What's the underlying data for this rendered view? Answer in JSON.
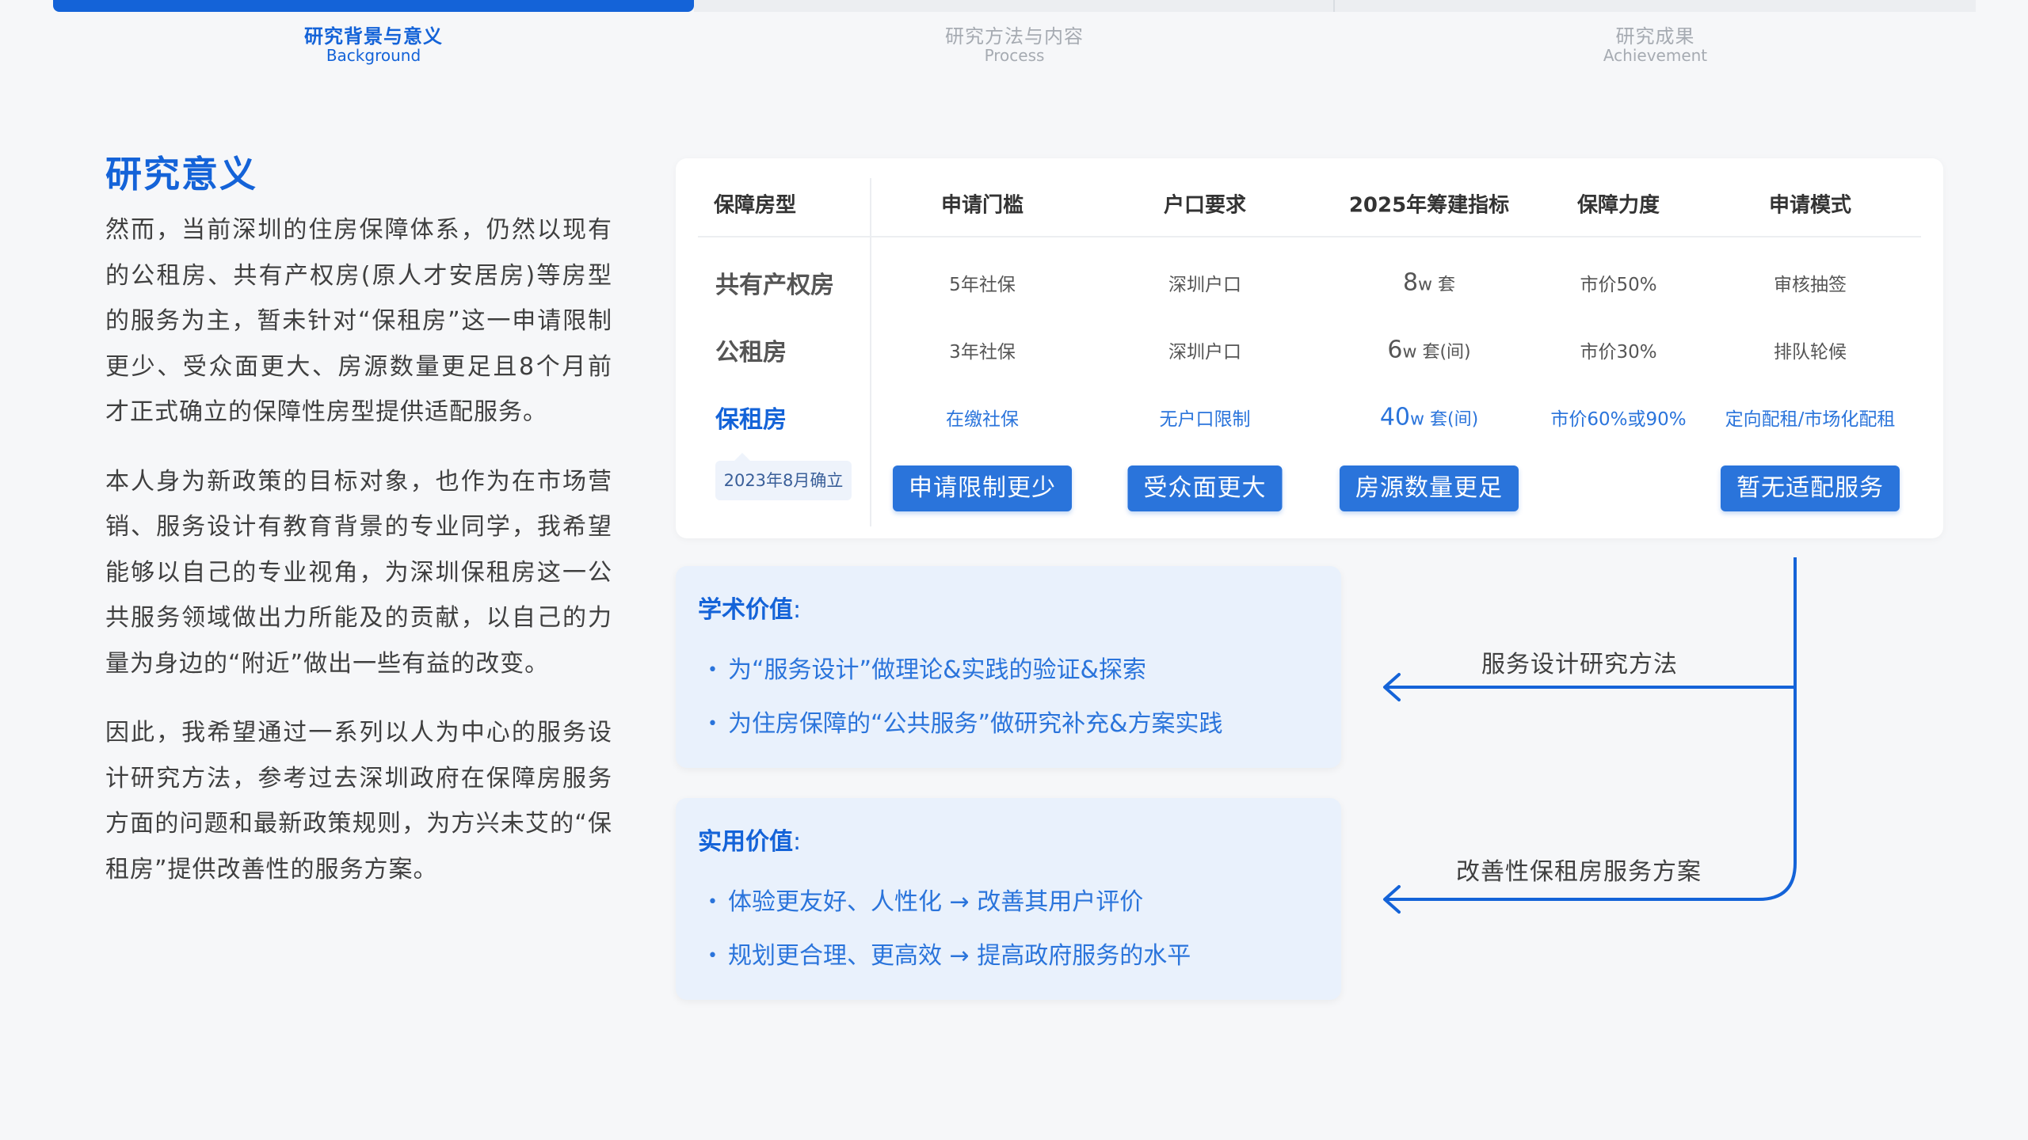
{
  "steps": [
    {
      "zh": "研究背景与意义",
      "en": "Background"
    },
    {
      "zh": "研究方法与内容",
      "en": "Process"
    },
    {
      "zh": "研究成果",
      "en": "Achievement"
    }
  ],
  "left": {
    "title": "研究意义",
    "paragraphs": [
      "然而，当前深圳的住房保障体系，仍然以现有的公租房、共有产权房(原人才安居房)等房型的服务为主，暂未针对“保租房”这一申请限制更少、受众面更大、房源数量更足且8个月前才正式确立的保障性房型提供适配服务。",
      "本人身为新政策的目标对象，也作为在市场营销、服务设计有教育背景的专业同学，我希望能够以自己的专业视角，为深圳保租房这一公共服务领域做出力所能及的贡献，以自己的力量为身边的“附近”做出一些有益的改变。",
      "因此，我希望通过一系列以人为中心的服务设计研究方法，参考过去深圳政府在保障房服务方面的问题和最新政策规则，为方兴未艾的“保租房”提供改善性的服务方案。"
    ]
  },
  "table": {
    "headers": [
      "保障房型",
      "申请门槛",
      "户口要求",
      "2025年筹建指标",
      "保障力度",
      "申请模式"
    ],
    "rows": [
      {
        "label": "共有产权房",
        "threshold": "5年社保",
        "hukou": "深圳户口",
        "quota_num": "8",
        "quota_unit": "w 套",
        "strength": "市价50%",
        "mode": "审核抽签"
      },
      {
        "label": "公租房",
        "threshold": "3年社保",
        "hukou": "深圳户口",
        "quota_num": "6",
        "quota_unit": "w 套(间)",
        "strength": "市价30%",
        "mode": "排队轮候"
      },
      {
        "label": "保租房",
        "threshold": "在缴社保",
        "hukou": "无户口限制",
        "quota_num": "40",
        "quota_unit": "w 套(间)",
        "strength": "市价60%或90%",
        "mode": "定向配租/市场化配租"
      }
    ],
    "date_note": "2023年8月确立",
    "tags": {
      "threshold": "申请限制更少",
      "hukou": "受众面更大",
      "quota": "房源数量更足",
      "mode": "暂无适配服务"
    }
  },
  "academic": {
    "title": "学术价值",
    "colon": ":",
    "items": [
      "为“服务设计”做理论&实践的验证&探索",
      "为住房保障的“公共服务”做研究补充&方案实践"
    ]
  },
  "practical": {
    "title": "实用价值",
    "colon": ":",
    "items": [
      "体验更友好、人性化 → 改善其用户评价",
      "规划更合理、更高效 → 提高政府服务的水平"
    ]
  },
  "arrows": {
    "method": "服务设计研究方法",
    "solution": "改善性保租房服务方案"
  },
  "colors": {
    "primary": "#1463d8",
    "accent": "#2a74db",
    "card_bg": "#e9f1fc",
    "page_bg": "#f6f7f9"
  }
}
